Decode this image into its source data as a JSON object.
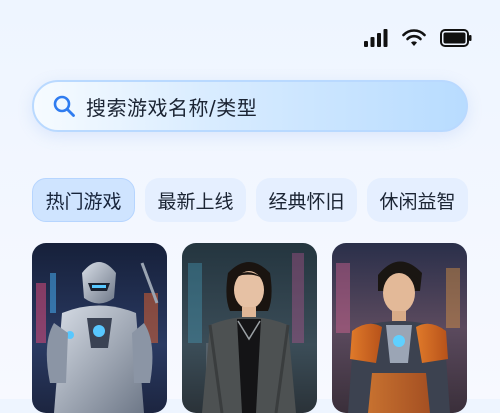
{
  "status_bar": {
    "icons": [
      "signal-icon",
      "wifi-icon",
      "battery-icon"
    ]
  },
  "search": {
    "placeholder": "搜索游戏名称/类型",
    "icon": "search-icon"
  },
  "tabs": [
    {
      "label": "热门游戏",
      "active": true
    },
    {
      "label": "最新上线",
      "active": false
    },
    {
      "label": "经典怀旧",
      "active": false
    },
    {
      "label": "休闲益智",
      "active": false
    }
  ],
  "cards": [
    {
      "image": "armored-robot-warrior"
    },
    {
      "image": "female-cyberpunk-character"
    },
    {
      "image": "male-mech-armor-hero"
    }
  ],
  "colors": {
    "background": "#eef5ff",
    "search_border": "#b9d9ff",
    "tab_bg": "#e5efff",
    "tab_active_bg": "#cfe4ff",
    "text": "#1b2433",
    "accent_blue": "#2f7cf0"
  }
}
